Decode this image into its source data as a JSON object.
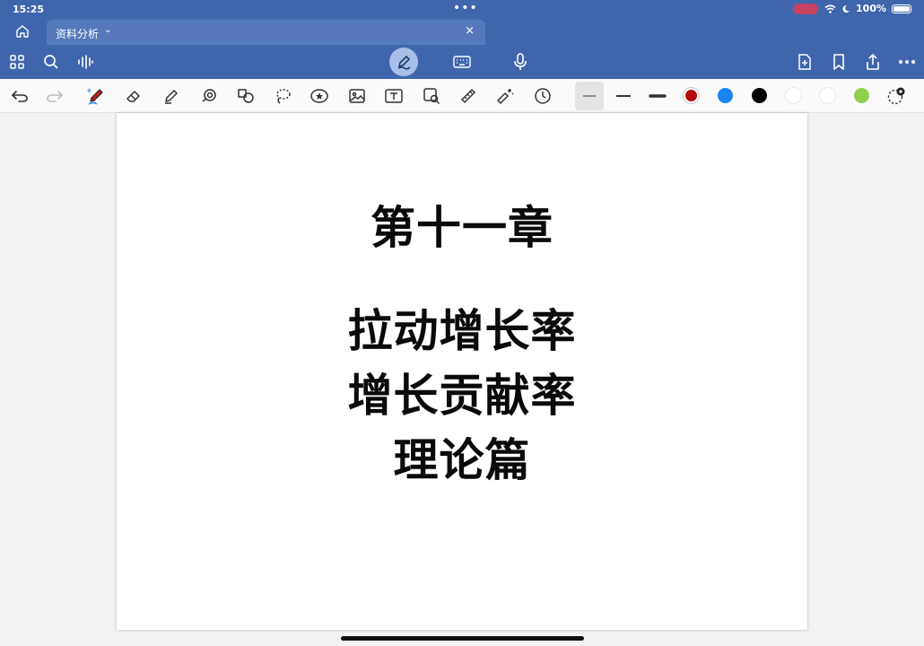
{
  "status_bar": {
    "time": "15:25",
    "battery_text": "100%"
  },
  "tab": {
    "title": "资料分析",
    "close_label": "×"
  },
  "canvas": {
    "lines": [
      "第十一章",
      "拉动增长率",
      "增长贡献率",
      "理论篇"
    ]
  },
  "toolbar": {
    "colors": [
      "#b50d0d",
      "#1a84f0",
      "#000000",
      "#ffffff",
      "#ffffff",
      "#8fd14f"
    ]
  },
  "theme": {
    "header_blue": "#3f66ad",
    "tab_blue": "#5579bc"
  }
}
